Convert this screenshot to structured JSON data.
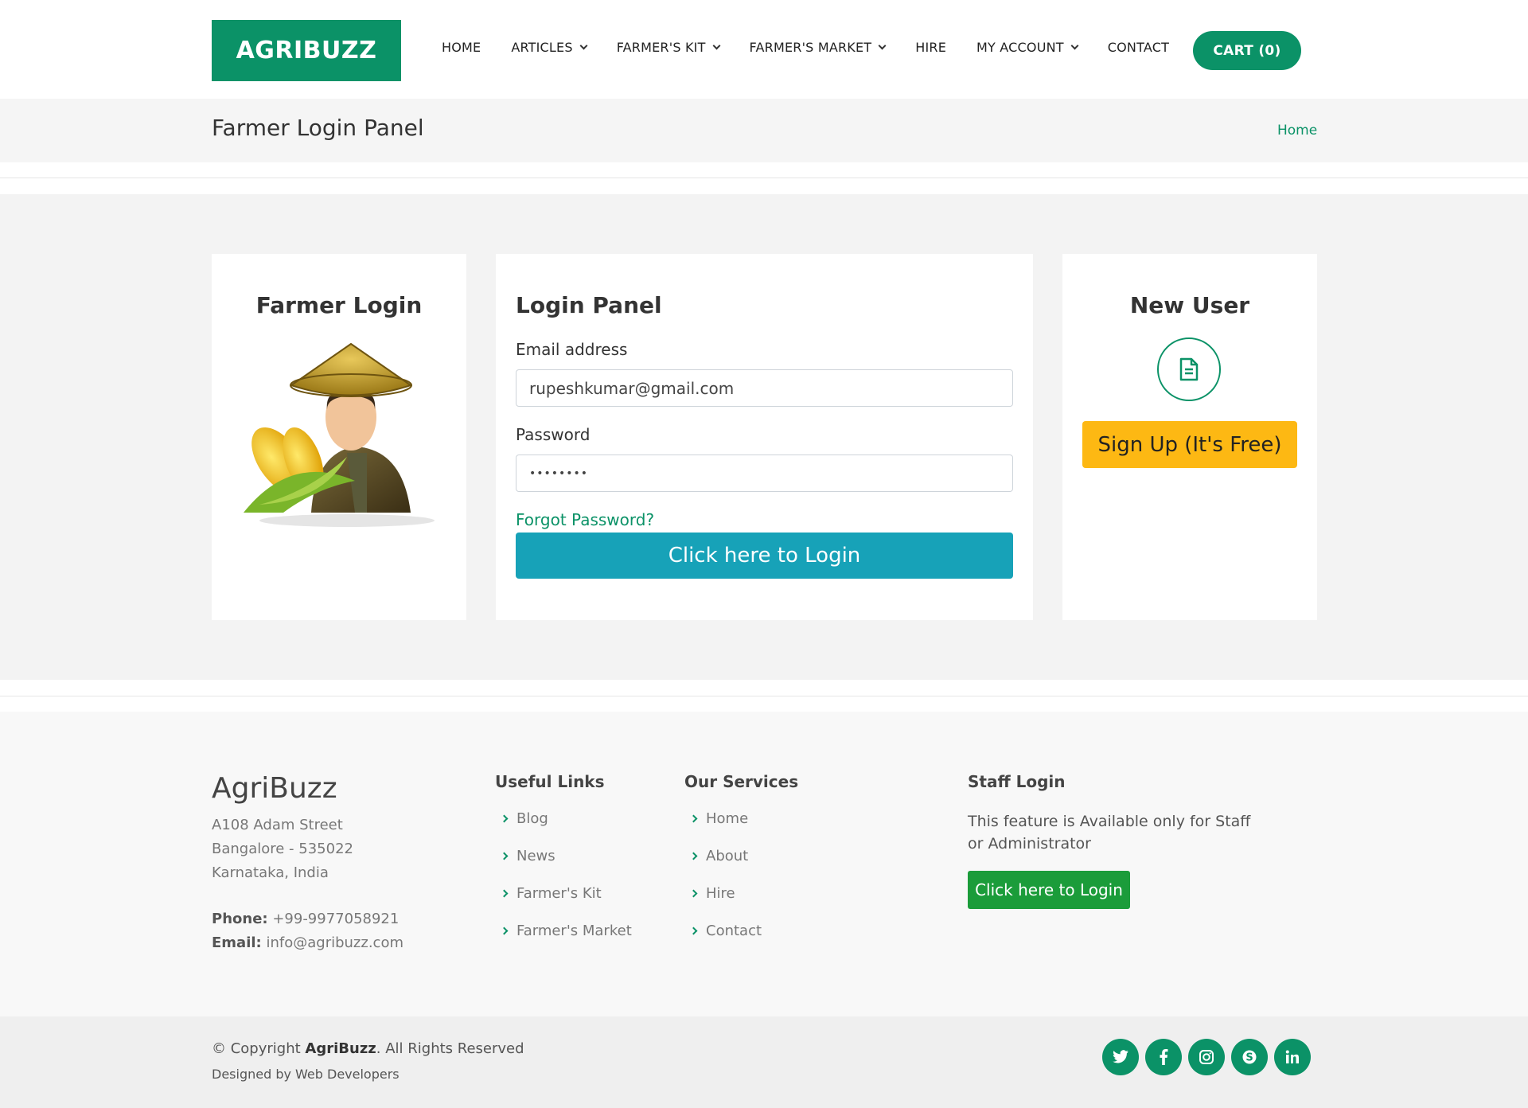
{
  "header": {
    "logo": "AGRIBUZZ",
    "nav": [
      {
        "label": "HOME",
        "dropdown": false
      },
      {
        "label": "ARTICLES",
        "dropdown": true
      },
      {
        "label": "FARMER'S KIT",
        "dropdown": true
      },
      {
        "label": "FARMER'S MARKET",
        "dropdown": true
      },
      {
        "label": "HIRE",
        "dropdown": false
      },
      {
        "label": "MY ACCOUNT",
        "dropdown": true
      },
      {
        "label": "CONTACT",
        "dropdown": false
      }
    ],
    "cart": "CART (0)"
  },
  "breadcrumb": {
    "title": "Farmer Login Panel",
    "home": "Home"
  },
  "farmer_card": {
    "title": "Farmer Login"
  },
  "login_panel": {
    "title": "Login Panel",
    "email_label": "Email address",
    "email_value": "rupeshkumar@gmail.com",
    "password_label": "Password",
    "password_value": "••••••••",
    "forgot": "Forgot Password?",
    "login_button": "Click here to Login"
  },
  "new_user": {
    "title": "New User",
    "icon": "document-icon",
    "signup_button": "Sign Up (It's Free)"
  },
  "footer": {
    "brand": "AgriBuzz",
    "address": [
      "A108 Adam Street",
      "Bangalore - 535022",
      "Karnataka, India"
    ],
    "phone_label": "Phone:",
    "phone": "+99-9977058921",
    "email_label": "Email:",
    "email": "info@agribuzz.com",
    "useful_links_title": "Useful Links",
    "useful_links": [
      "Blog",
      "News",
      "Farmer's Kit",
      "Farmer's Market"
    ],
    "services_title": "Our Services",
    "services": [
      "Home",
      "About",
      "Hire",
      "Contact"
    ],
    "staff_title": "Staff Login",
    "staff_desc": "This feature is Available only for Staff or Administrator",
    "staff_button": "Click here to Login"
  },
  "bottom": {
    "copy_prefix": "© Copyright",
    "copy_brand": "AgriBuzz",
    "copy_suffix": ". All Rights Reserved",
    "designed": "Designed by Web Developers",
    "socials": [
      "twitter-icon",
      "facebook-icon",
      "instagram-icon",
      "skype-icon",
      "linkedin-icon"
    ]
  },
  "colors": {
    "brand_green": "#0b9267",
    "login_blue": "#17a2b8",
    "signup_yellow": "#fdb813",
    "staff_green": "#1b9c3a"
  }
}
